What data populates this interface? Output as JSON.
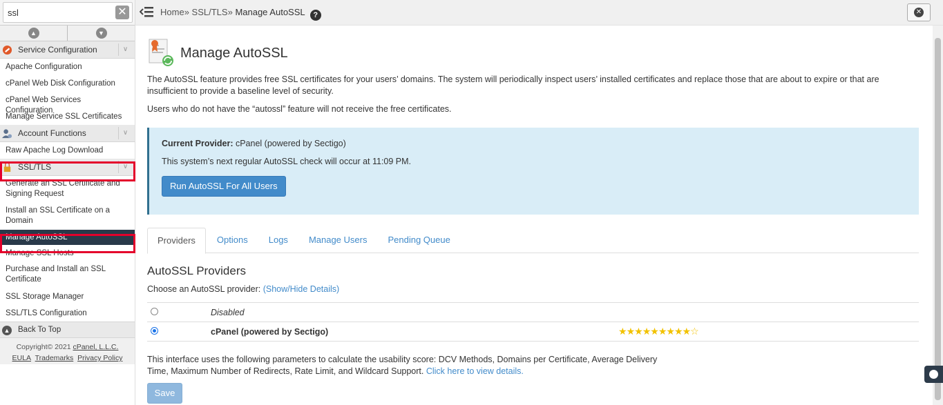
{
  "search": {
    "value": "ssl",
    "clear": "✕"
  },
  "collapse": {
    "up": "▲",
    "down": "▼"
  },
  "sidebar": {
    "cat_service": "Service Configuration",
    "service_items": [
      "Apache Configuration",
      "cPanel Web Disk Configuration",
      "cPanel Web Services Configuration",
      "Manage Service SSL Certificates"
    ],
    "cat_account": "Account Functions",
    "account_items": [
      "Raw Apache Log Download"
    ],
    "cat_ssl": "SSL/TLS",
    "ssl_items": [
      "Generate an SSL Certificate and Signing Request",
      "Install an SSL Certificate on a Domain",
      "Manage AutoSSL",
      "Manage SSL Hosts",
      "Purchase and Install an SSL Certificate",
      "SSL Storage Manager",
      "SSL/TLS Configuration"
    ],
    "chevron": "∨",
    "back_to_top": "Back To Top"
  },
  "footer": {
    "copyright": "Copyright© 2021 ",
    "company": "cPanel, L.L.C.",
    "eula": "EULA",
    "trademarks": "Trademarks",
    "privacy": "Privacy Policy"
  },
  "topbar": {
    "home": "Home",
    "sep": "»",
    "ssl": "SSL/TLS",
    "current": "Manage AutoSSL",
    "help": "?",
    "close": "✕"
  },
  "main": {
    "title": "Manage AutoSSL",
    "intro": "The AutoSSL feature provides free SSL certificates for your users’ domains. The system will periodically inspect users’ installed certificates and replace those that are about to expire or that are insufficient to provide a baseline level of security.",
    "note": "Users who do not have the “autossl” feature will not receive the free certificates.",
    "provider_label": "Current Provider:",
    "provider_value": " cPanel (powered by Sectigo)",
    "next_check": "This system’s next regular AutoSSL check will occur at 11:09 PM.",
    "run_button": "Run AutoSSL For All Users",
    "tabs": [
      "Providers",
      "Options",
      "Logs",
      "Manage Users",
      "Pending Queue"
    ],
    "providers_title": "AutoSSL Providers",
    "choose_label": "Choose an AutoSSL provider: ",
    "show_hide": "(Show/Hide Details)",
    "providers": [
      {
        "name": "Disabled",
        "selected": false
      },
      {
        "name": "cPanel (powered by Sectigo)",
        "selected": true,
        "rating": 9,
        "rating_max": 10
      }
    ],
    "score_text": "This interface uses the following parameters to calculate the usability score: DCV Methods, Domains per Certificate, Average Delivery Time, Maximum Number of Redirects, Rate Limit, and Wildcard Support. ",
    "score_link": "Click here to view details.",
    "save_button": "Save"
  },
  "colors": {
    "accent": "#428bca",
    "sidebar_active": "#293a4a",
    "highlight": "#e4002b",
    "alert_bg": "#d9edf7",
    "star": "#f2c200"
  },
  "icons": [
    "search-clear-icon",
    "chevron-up-icon",
    "chevron-down-icon",
    "wrench-icon",
    "user-icon",
    "lock-icon",
    "arrow-up-icon",
    "menu-icon",
    "help-icon",
    "close-icon",
    "certificate-icon",
    "chat-icon"
  ]
}
